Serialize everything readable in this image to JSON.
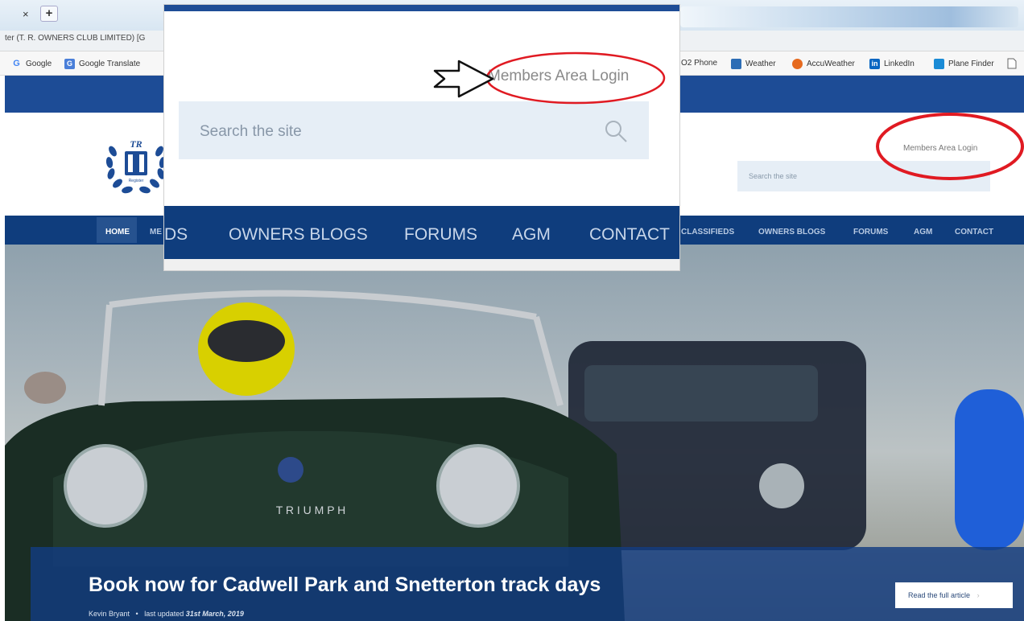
{
  "browser": {
    "tab_close": "×",
    "tab_new": "+",
    "page_title": "ter (T. R. OWNERS CLUB LIMITED) [G",
    "bookmarks": [
      {
        "label": "Google",
        "icon": "google-icon",
        "color": "#4285f4"
      },
      {
        "label": "Google Translate",
        "icon": "translate-icon",
        "color": "#4a7fd9"
      },
      {
        "label": "O2 Phone",
        "icon": "",
        "color": ""
      },
      {
        "label": "Weather",
        "icon": "weather-icon",
        "color": "#2d6db5"
      },
      {
        "label": "AccuWeather",
        "icon": "accuweather-icon",
        "color": "#e66a1f"
      },
      {
        "label": "LinkedIn",
        "icon": "linkedin-icon",
        "color": "#0a66c2"
      },
      {
        "label": "Plane Finder",
        "icon": "plane-finder-icon",
        "color": "#1a8bd6"
      }
    ]
  },
  "site": {
    "members_login": "Members Area Login",
    "search_placeholder": "Search the site",
    "logo_text": "TR",
    "logo_subtext": "Register",
    "nav": {
      "home": "HOME",
      "partial_left": "ME",
      "items": [
        "CLASSIFIEDS",
        "OWNERS BLOGS",
        "FORUMS",
        "AGM",
        "CONTACT"
      ]
    },
    "hero": {
      "headline": "Book now for Cadwell Park and Snetterton track days",
      "author": "Kevin Bryant",
      "separator": "•",
      "updated_prefix": "last updated",
      "date": "31st March, 2019",
      "read_more": "Read the full article",
      "read_more_chevron": "›",
      "car_badge": "T R I U M P H"
    }
  },
  "zoom": {
    "members_login": "Members Area Login",
    "search_placeholder": "Search the site",
    "nav_partial": "DS",
    "nav_items": [
      "OWNERS BLOGS",
      "FORUMS",
      "AGM",
      "CONTACT"
    ]
  },
  "colors": {
    "brand_blue": "#1d4c96",
    "nav_blue": "#0f3d7d",
    "annotation_red": "#e01a22"
  }
}
